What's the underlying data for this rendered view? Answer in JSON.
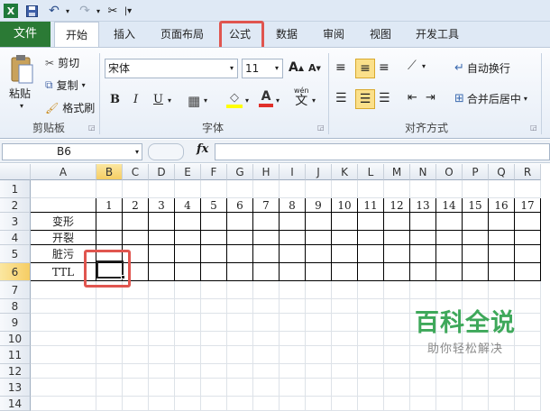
{
  "colors": {
    "accent": "#2b7a35",
    "highlight_red": "#e0554f",
    "selection": "#f8d65e"
  },
  "quick_access": {
    "icons": [
      "excel-logo-icon",
      "save-icon",
      "undo-icon",
      "redo-icon",
      "customize-icon"
    ]
  },
  "tabs": {
    "file": "文件",
    "home": "开始",
    "insert": "插入",
    "page_layout": "页面布局",
    "formulas": "公式",
    "data": "数据",
    "review": "审阅",
    "view": "视图",
    "developer": "开发工具"
  },
  "clipboard": {
    "paste": "粘贴",
    "cut": "剪切",
    "copy": "复制",
    "format_painter": "格式刷",
    "label": "剪贴板"
  },
  "font": {
    "name": "宋体",
    "size": "11",
    "bold": "B",
    "italic": "I",
    "underline": "U",
    "color_letter": "A",
    "wen": "wén",
    "wen_char": "文",
    "grow": "A",
    "shrink": "A",
    "label": "字体"
  },
  "alignment": {
    "wrap_text": "自动换行",
    "merge_center": "合并后居中",
    "label": "对齐方式"
  },
  "formula_bar": {
    "name_box": "B6",
    "fx": "fx",
    "value": ""
  },
  "grid": {
    "columns": [
      "A",
      "B",
      "C",
      "D",
      "E",
      "F",
      "G",
      "H",
      "I",
      "J",
      "K",
      "L",
      "M",
      "N",
      "O",
      "P",
      "Q",
      "R"
    ],
    "rows": [
      "1",
      "2",
      "3",
      "4",
      "5",
      "6",
      "7",
      "8",
      "9",
      "10",
      "11",
      "12",
      "13",
      "14"
    ],
    "row2_numbers": [
      "1",
      "2",
      "3",
      "4",
      "5",
      "6",
      "7",
      "8",
      "9",
      "10",
      "11",
      "12",
      "13",
      "14",
      "15",
      "16",
      "17"
    ],
    "labels": [
      "变形",
      "开裂",
      "脏污",
      "TTL"
    ],
    "selected": "B6"
  },
  "watermark": {
    "title": "百科全说",
    "subtitle": "助你轻松解决"
  }
}
